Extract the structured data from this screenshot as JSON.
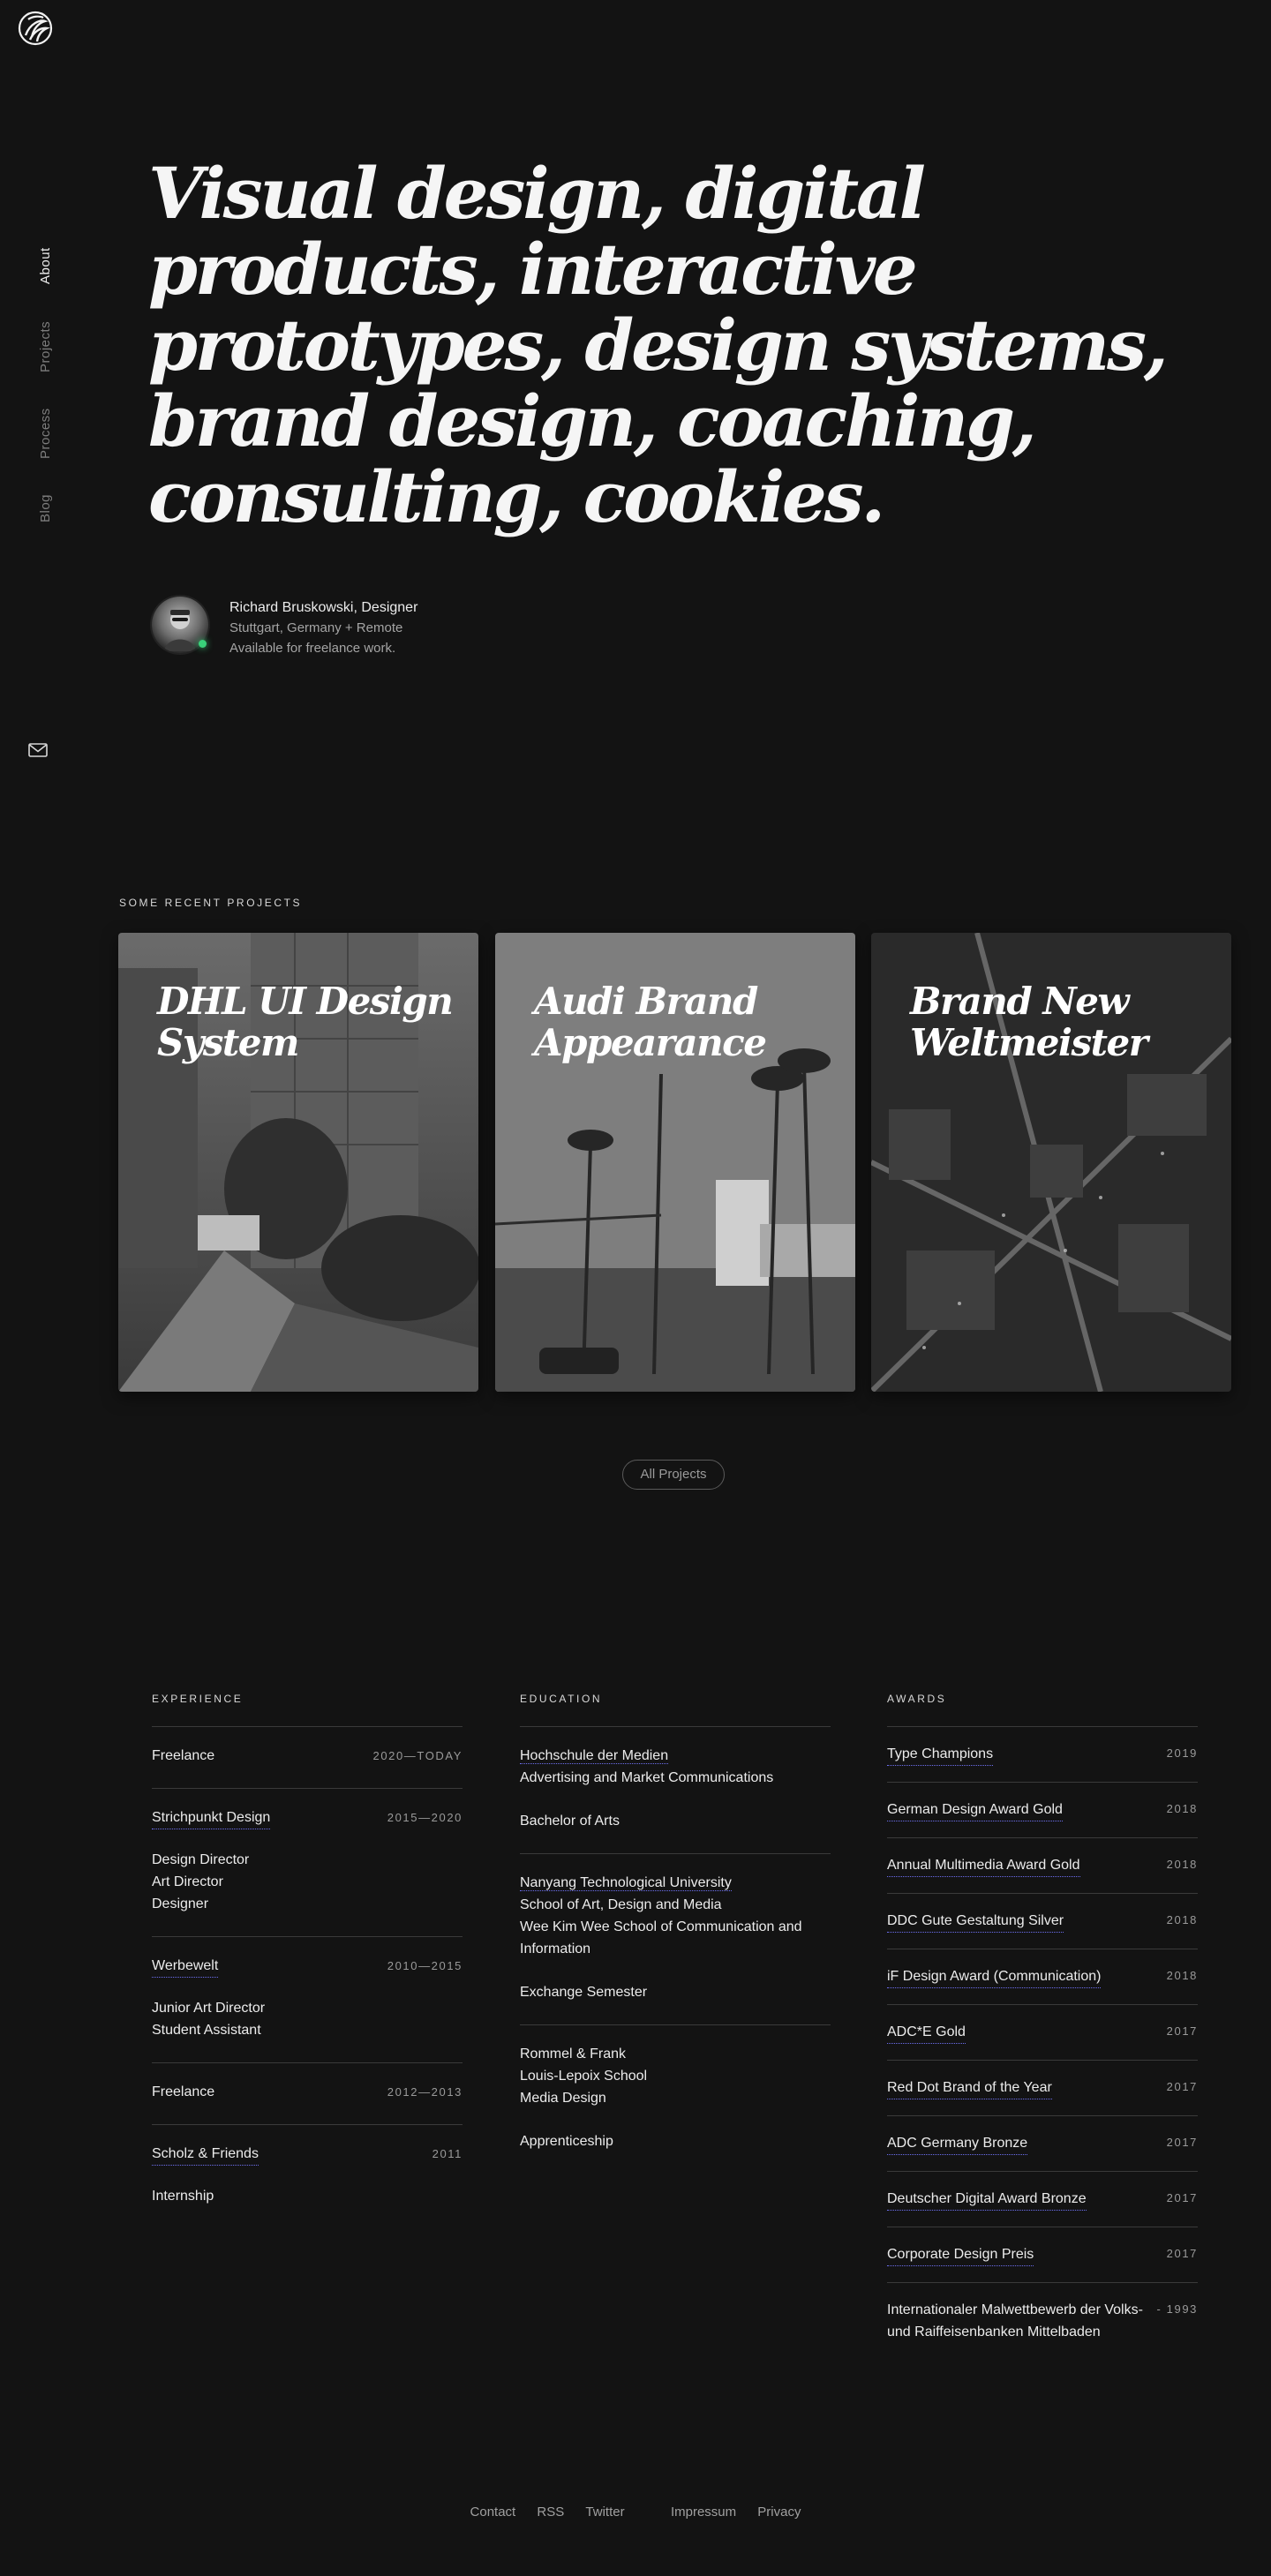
{
  "nav": {
    "items": [
      {
        "label": "About",
        "active": true
      },
      {
        "label": "Projects",
        "active": false
      },
      {
        "label": "Process",
        "active": false
      },
      {
        "label": "Blog",
        "active": false
      }
    ],
    "mail_icon": "mail-icon",
    "logo_icon": "swirl-logo-icon"
  },
  "hero": {
    "title": "Visual design, digital products, interactive prototypes, design systems, brand design, coaching, consulting, cookies.",
    "author_name": "Richard Bruskowski, Designer",
    "author_location": "Stuttgart, Germany + Remote",
    "author_status": "Available for freelance work."
  },
  "projects": {
    "label": "Some recent projects",
    "cards": [
      {
        "title": "DHL UI Design System"
      },
      {
        "title": "Audi Brand Appearance"
      },
      {
        "title": "Brand New Weltmeister"
      }
    ],
    "all_label": "All Projects"
  },
  "experience": {
    "label": "Experience",
    "entries": [
      {
        "title": "Freelance",
        "years": "2020—TODAY",
        "lines": []
      },
      {
        "title": "Strichpunkt Design",
        "years": "2015—2020",
        "lines": [
          "Design Director",
          "Art Director",
          "Designer"
        ]
      },
      {
        "title": "Werbewelt",
        "years": "2010—2015",
        "lines": [
          "Junior Art Director",
          "Student Assistant"
        ]
      },
      {
        "title": "Freelance",
        "years": "2012—2013",
        "lines": []
      },
      {
        "title": "Scholz & Friends",
        "years": "2011",
        "lines": [
          "Internship"
        ]
      }
    ]
  },
  "education": {
    "label": "Education",
    "entries": [
      {
        "lines": [
          "Hochschule der Medien",
          "Advertising and Market Communications"
        ],
        "degree": "Bachelor of Arts"
      },
      {
        "lines": [
          "Nanyang Technological University",
          "School of Art, Design and Media",
          "Wee Kim Wee School of Communication and Information"
        ],
        "degree": "Exchange Semester"
      },
      {
        "lines": [
          "Rommel & Frank",
          "Louis-Lepoix School",
          "Media Design"
        ],
        "degree": "Apprenticeship"
      }
    ]
  },
  "awards": {
    "label": "Awards",
    "entries": [
      {
        "name": "Type Champions",
        "year": "2019"
      },
      {
        "name": "German Design Award Gold",
        "year": "2018"
      },
      {
        "name": "Annual Multimedia Award Gold",
        "year": "2018"
      },
      {
        "name": "DDC Gute Gestaltung Silver",
        "year": "2018"
      },
      {
        "name": "iF Design Award (Communication)",
        "year": "2018"
      },
      {
        "name": "ADC*E Gold",
        "year": "2017"
      },
      {
        "name": "Red Dot Brand of the Year",
        "year": "2017"
      },
      {
        "name": "ADC Germany Bronze",
        "year": "2017"
      },
      {
        "name": "Deutscher Digital Award Bronze",
        "year": "2017"
      },
      {
        "name": "Corporate Design Preis",
        "year": "2017"
      },
      {
        "name": "Internationaler Malwettbewerb der Volks- und Raiffeisenbanken Mittelbaden",
        "year": "- 1993"
      }
    ]
  },
  "footer": {
    "links": [
      "Contact",
      "RSS",
      "Twitter",
      "Impressum",
      "Privacy"
    ]
  }
}
